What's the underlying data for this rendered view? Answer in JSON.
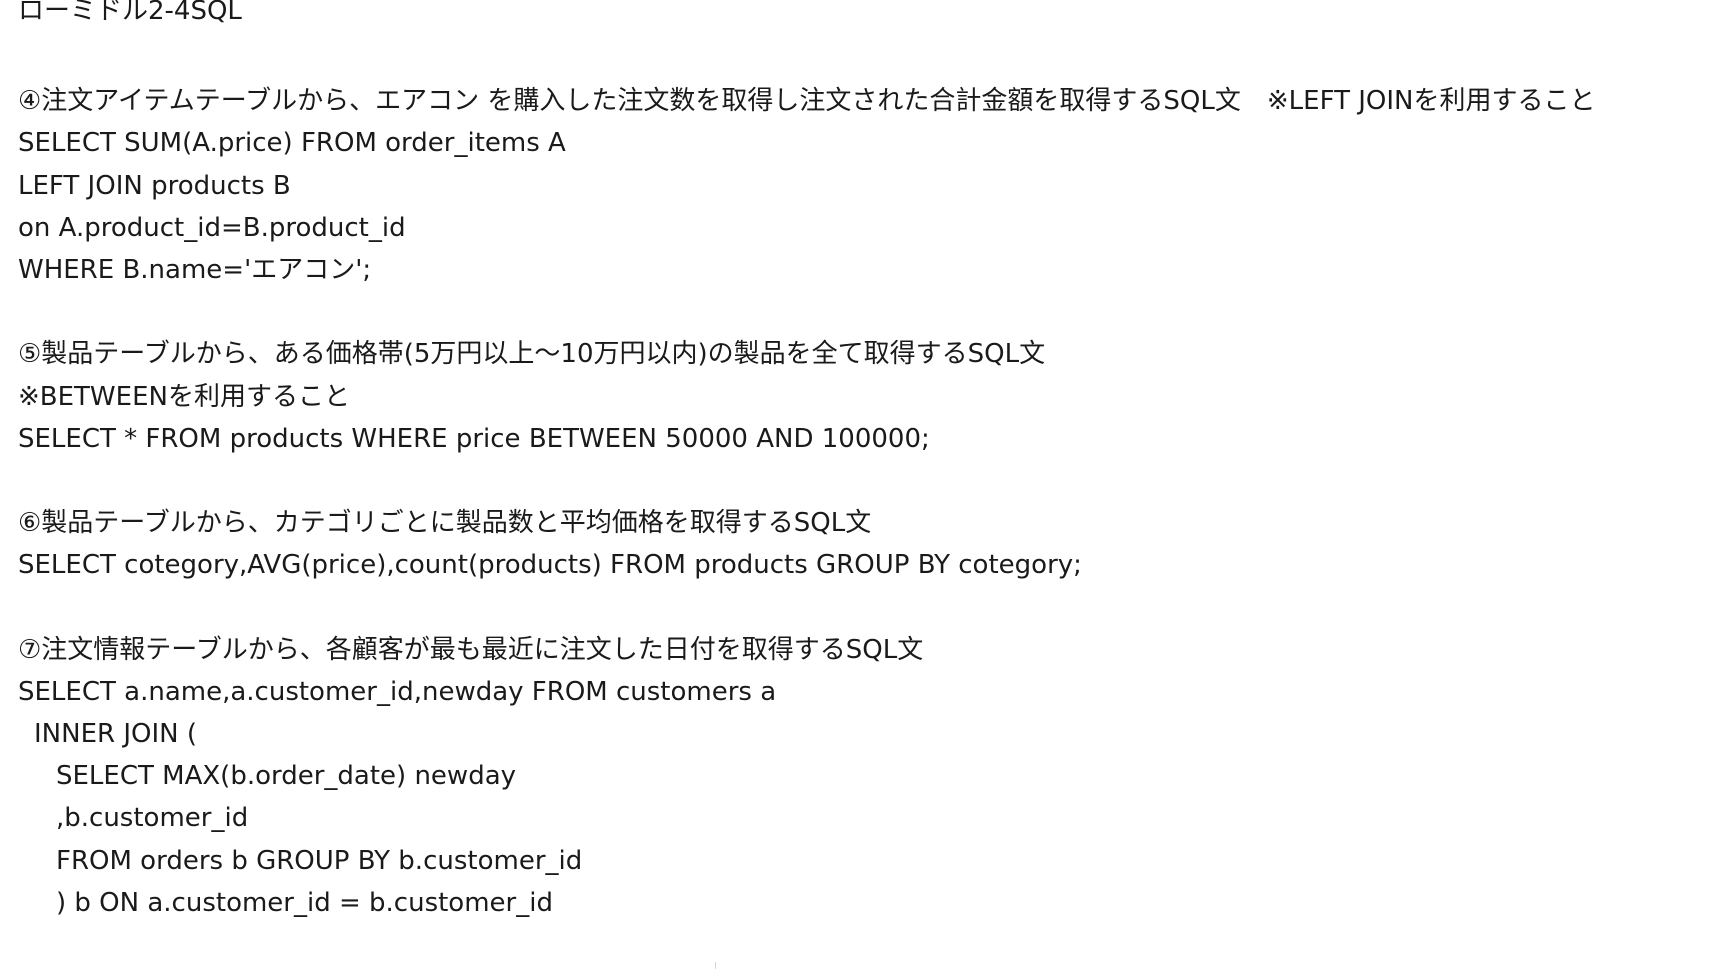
{
  "document": {
    "title": "ローミドル2-4SQL",
    "sections": [
      {
        "prompt": "④注文アイテムテーブルから、エアコン を購入した注文数を取得し注文された合計金額を取得するSQL文　※LEFT JOINを利用すること",
        "lines": [
          "SELECT SUM(A.price) FROM order_items A",
          "LEFT JOIN products B",
          "on A.product_id=B.product_id",
          "WHERE B.name='エアコン';"
        ]
      },
      {
        "prompt": "⑤製品テーブルから、ある価格帯(5万円以上〜10万円以内)の製品を全て取得するSQL文",
        "note": "※BETWEENを利用すること",
        "lines": [
          "SELECT * FROM products WHERE price BETWEEN 50000 AND 100000;"
        ]
      },
      {
        "prompt": "⑥製品テーブルから、カテゴリごとに製品数と平均価格を取得するSQL文",
        "lines": [
          "SELECT cotegory,AVG(price),count(products) FROM products GROUP BY cotegory;"
        ]
      },
      {
        "prompt": "⑦注文情報テーブルから、各顧客が最も最近に注文した日付を取得するSQL文",
        "lines": [
          "SELECT a.name,a.customer_id,newday FROM customers a",
          "INNER JOIN (",
          "SELECT MAX(b.order_date) newday",
          ",b.customer_id",
          "FROM orders b GROUP BY b.customer_id",
          ") b ON a.customer_id = b.customer_id"
        ]
      }
    ]
  }
}
